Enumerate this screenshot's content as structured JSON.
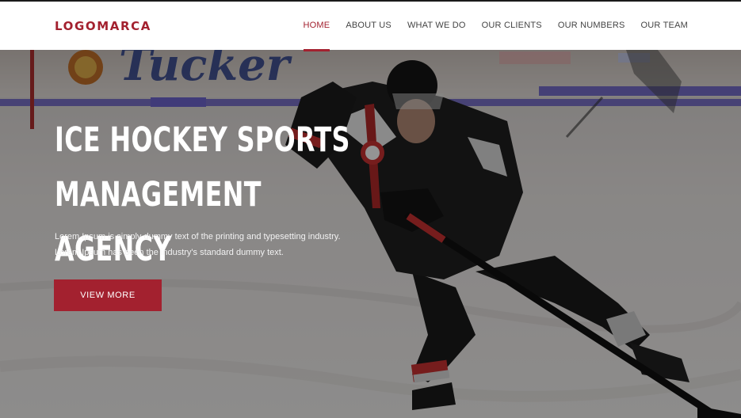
{
  "header": {
    "logo": "LOGOMARCA",
    "nav": [
      {
        "label": "HOME",
        "active": true
      },
      {
        "label": "ABOUT US",
        "active": false
      },
      {
        "label": "WHAT WE DO",
        "active": false
      },
      {
        "label": "OUR CLIENTS",
        "active": false
      },
      {
        "label": "OUR NUMBERS",
        "active": false
      },
      {
        "label": "OUR TEAM",
        "active": false
      }
    ]
  },
  "hero": {
    "title_line1": "ICE HOCKEY SPORTS",
    "title_line2": "MANAGEMENT AGENCY",
    "text": "Lorem Ipsum is simply dummy text of the printing and typesetting industry. Lorem Ipsum has been the industry's standard dummy text.",
    "button_label": "VIEW MORE",
    "background": "ice-hockey-player-photo"
  },
  "colors": {
    "accent": "#a3212f",
    "header_bg": "#ffffff",
    "nav_text": "#444444"
  }
}
